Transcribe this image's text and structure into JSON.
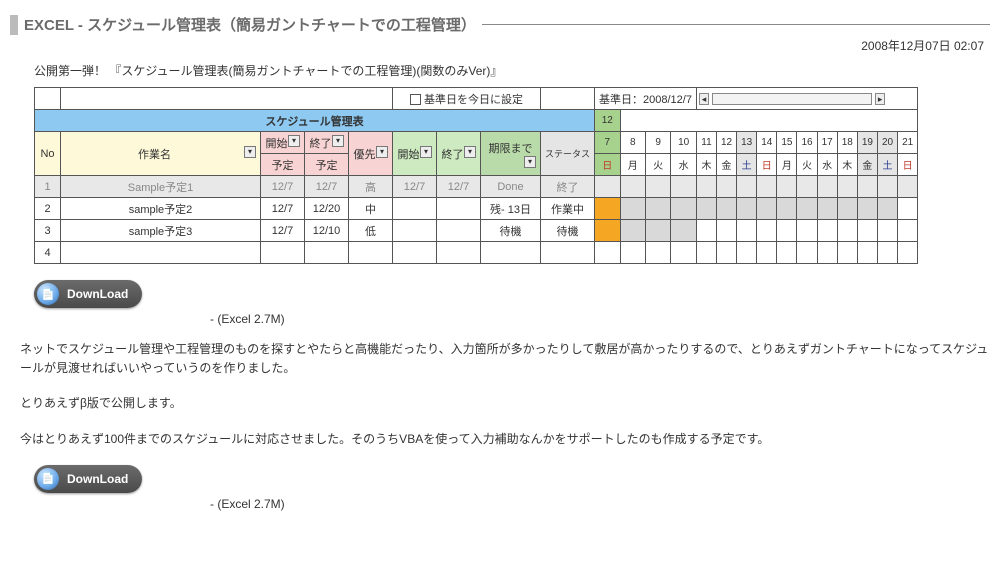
{
  "title": "EXCEL - スケジュール管理表（簡易ガントチャートでの工程管理）",
  "timestamp": "2008年12月07日 02:07",
  "subtitle": "公開第一弾！ 『スケジュール管理表(簡易ガントチャートでの工程管理)(関数のみVer)』",
  "toprow": {
    "set_today": "基準日を今日に設定",
    "base_date_label": "基準日：",
    "base_date": "2008/12/7",
    "month12": "12"
  },
  "headers": {
    "sheet_title": "スケジュール管理表",
    "no": "No",
    "task": "作業名",
    "start": "開始",
    "end": "終了",
    "plan": "予定",
    "priority": "優先",
    "begin": "開始",
    "finish": "終了",
    "due": "期限まで",
    "status": "ステータス"
  },
  "days": [
    "7",
    "8",
    "9",
    "10",
    "11",
    "12",
    "13",
    "14",
    "15",
    "16",
    "17",
    "18",
    "19",
    "20",
    "21"
  ],
  "dows": [
    "日",
    "月",
    "火",
    "水",
    "木",
    "金",
    "土",
    "日",
    "月",
    "火",
    "水",
    "木",
    "金",
    "土",
    "日"
  ],
  "rows": [
    {
      "no": "1",
      "task": "Sample予定1",
      "start": "12/7",
      "end": "12/7",
      "priority": "高",
      "begin": "12/7",
      "finish": "12/7",
      "due": "Done",
      "status": "終了",
      "bar": {
        "from": 0,
        "to": 0,
        "cls": "bar-red"
      }
    },
    {
      "no": "2",
      "task": "sample予定2",
      "start": "12/7",
      "end": "12/20",
      "priority": "中",
      "begin": "",
      "finish": "",
      "due": "残- 13日",
      "status": "作業中",
      "bar": {
        "from": 0,
        "to": 0,
        "cls": "bar-orange",
        "trail": 13
      }
    },
    {
      "no": "3",
      "task": "sample予定3",
      "start": "12/7",
      "end": "12/10",
      "priority": "低",
      "begin": "",
      "finish": "",
      "due": "待機",
      "status": "待機",
      "bar": {
        "from": 0,
        "to": 0,
        "cls": "bar-orange",
        "trail": 3
      }
    },
    {
      "no": "4",
      "task": "",
      "start": "",
      "end": "",
      "priority": "",
      "begin": "",
      "finish": "",
      "due": "",
      "status": "",
      "bar": null
    }
  ],
  "download": {
    "label": "DownLoad",
    "caption": "- (Excel 2.7M)"
  },
  "body": {
    "p1": "ネットでスケジュール管理や工程管理のものを探すとやたらと高機能だったり、入力箇所が多かったりして敷居が高かったりするので、とりあえずガントチャートになってスケジュールが見渡せればいいやっていうのを作りました。",
    "p2": "とりあえずβ版で公開します。",
    "p3": "今はとりあえず100件までのスケジュールに対応させました。そのうちVBAを使って入力補助なんかをサポートしたのも作成する予定です。"
  }
}
